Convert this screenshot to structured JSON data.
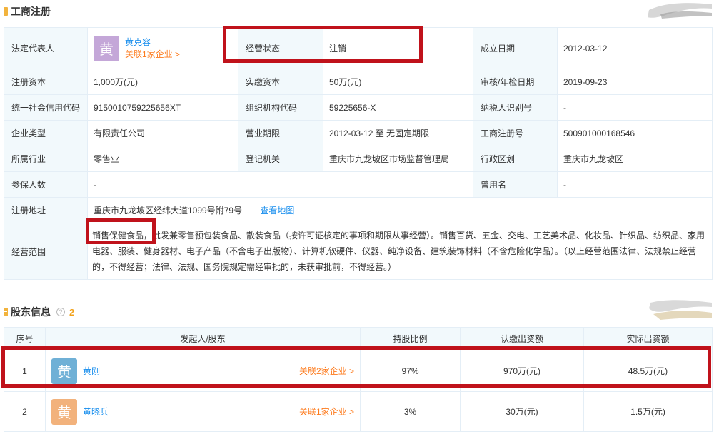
{
  "section1": {
    "title": "工商注册"
  },
  "legal_rep": {
    "label": "法定代表人",
    "avatar_char": "黄",
    "name": "黄克容",
    "related": "关联1家企业 >"
  },
  "status": {
    "label": "经营状态",
    "value": "注销"
  },
  "established": {
    "label": "成立日期",
    "value": "2012-03-12"
  },
  "reg_capital": {
    "label": "注册资本",
    "value": "1,000万(元)"
  },
  "paid_capital": {
    "label": "实缴资本",
    "value": "50万(元)"
  },
  "approval_date": {
    "label": "审核/年检日期",
    "value": "2019-09-23"
  },
  "credit_code": {
    "label": "统一社会信用代码",
    "value": "9150010759225656XT"
  },
  "org_code": {
    "label": "组织机构代码",
    "value": "59225656-X"
  },
  "taxpayer_id": {
    "label": "纳税人识别号",
    "value": "-"
  },
  "company_type": {
    "label": "企业类型",
    "value": "有限责任公司"
  },
  "biz_term": {
    "label": "营业期限",
    "value": "2012-03-12 至 无固定期限"
  },
  "reg_no": {
    "label": "工商注册号",
    "value": "500901000168546"
  },
  "industry": {
    "label": "所属行业",
    "value": "零售业"
  },
  "reg_authority": {
    "label": "登记机关",
    "value": "重庆市九龙坡区市场监督管理局"
  },
  "district": {
    "label": "行政区划",
    "value": "重庆市九龙坡区"
  },
  "insured": {
    "label": "参保人数",
    "value": "-"
  },
  "former_name": {
    "label": "曾用名",
    "value": "-"
  },
  "address": {
    "label": "注册地址",
    "value": "重庆市九龙坡区经纬大道1099号附79号",
    "map_link": "查看地图"
  },
  "scope": {
    "label": "经营范围",
    "value": "销售保健食品，批发兼零售预包装食品、散装食品（按许可证核定的事项和期限从事经营）。销售百货、五金、交电、工艺美术品、化妆品、针织品、纺织品、家用电器、服装、健身器材、电子产品（不含电子出版物）、计算机软硬件、仪器、纯净设备、建筑装饰材料（不含危险化学品）。（以上经营范围法律、法规禁止经营的，不得经营；法律、法规、国务院规定需经审批的，未获审批前，不得经营。）"
  },
  "section2": {
    "title": "股东信息",
    "help": "?",
    "count": "2"
  },
  "shareholder_table": {
    "headers": {
      "no": "序号",
      "holder": "发起人/股东",
      "ratio": "持股比例",
      "subscribed": "认缴出资额",
      "actual": "实际出资额"
    },
    "rows": [
      {
        "no": "1",
        "avatar_char": "黄",
        "name": "黄刚",
        "related": "关联2家企业 >",
        "ratio": "97%",
        "subscribed": "970万(元)",
        "actual": "48.5万(元)"
      },
      {
        "no": "2",
        "avatar_char": "黄",
        "name": "黄晓兵",
        "related": "关联1家企业 >",
        "ratio": "3%",
        "subscribed": "30万(元)",
        "actual": "1.5万(元)"
      }
    ]
  },
  "colors": {
    "highlight_box": "#c0121b",
    "link": "#128bed",
    "related_link": "#fd7a1c",
    "label_bg": "#f2f9fc",
    "section_mark": "#f2b33d"
  }
}
